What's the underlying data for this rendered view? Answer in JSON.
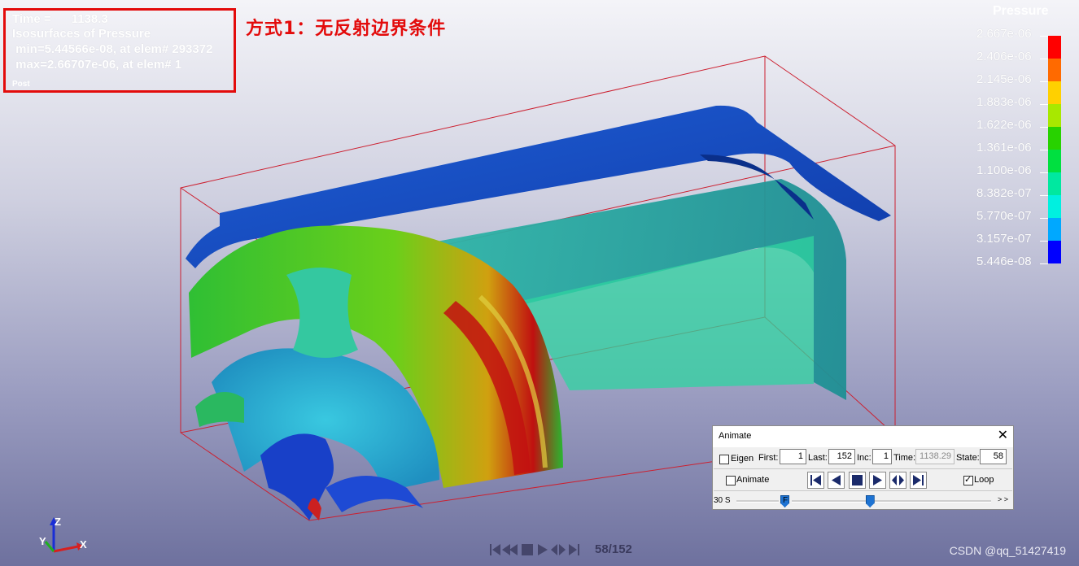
{
  "info": {
    "time_label": "Time =",
    "time_value": "1138.3",
    "plot_label": "Isosurfaces of Pressure",
    "min_text": " min=5.44566e-08, at elem# 293372",
    "max_text": " max=2.66707e-06, at elem# 1",
    "small_label": "Post"
  },
  "annotation": "方式1：无反射边界条件",
  "legend": {
    "title": "Pressure",
    "labels": [
      "2.667e-06",
      "2.406e-06",
      "2.145e-06",
      "1.883e-06",
      "1.622e-06",
      "1.361e-06",
      "1.100e-06",
      "8.382e-07",
      "5.770e-07",
      "3.157e-07",
      "5.446e-08"
    ],
    "colors": [
      "#ff0000",
      "#ff6a00",
      "#ffd000",
      "#a8e800",
      "#28d200",
      "#00e040",
      "#00e8a0",
      "#00f0e0",
      "#00a8ff",
      "#0000ff"
    ]
  },
  "triad": {
    "z": "Z",
    "y": "Y",
    "x": "X"
  },
  "animate": {
    "title": "Animate",
    "close": "✕",
    "eigen_label": "Eigen",
    "eigen_checked": false,
    "first_label": "First:",
    "first_value": "1",
    "last_label": "Last:",
    "last_value": "152",
    "inc_label": "Inc:",
    "inc_value": "1",
    "time_label": "Time:",
    "time_value": "1138.29",
    "state_label": "State:",
    "state_value": "58",
    "animate_label": "Animate",
    "animate_checked": false,
    "loop_label": "Loop",
    "loop_checked": true,
    "speed_label": "30 S",
    "speed_fraction": 0.27,
    "frame_label": "F",
    "frame_fraction": 0.37,
    "end_label": "> >"
  },
  "status": {
    "frame_counter": "58/152"
  },
  "watermark": "CSDN @qq_51427419"
}
